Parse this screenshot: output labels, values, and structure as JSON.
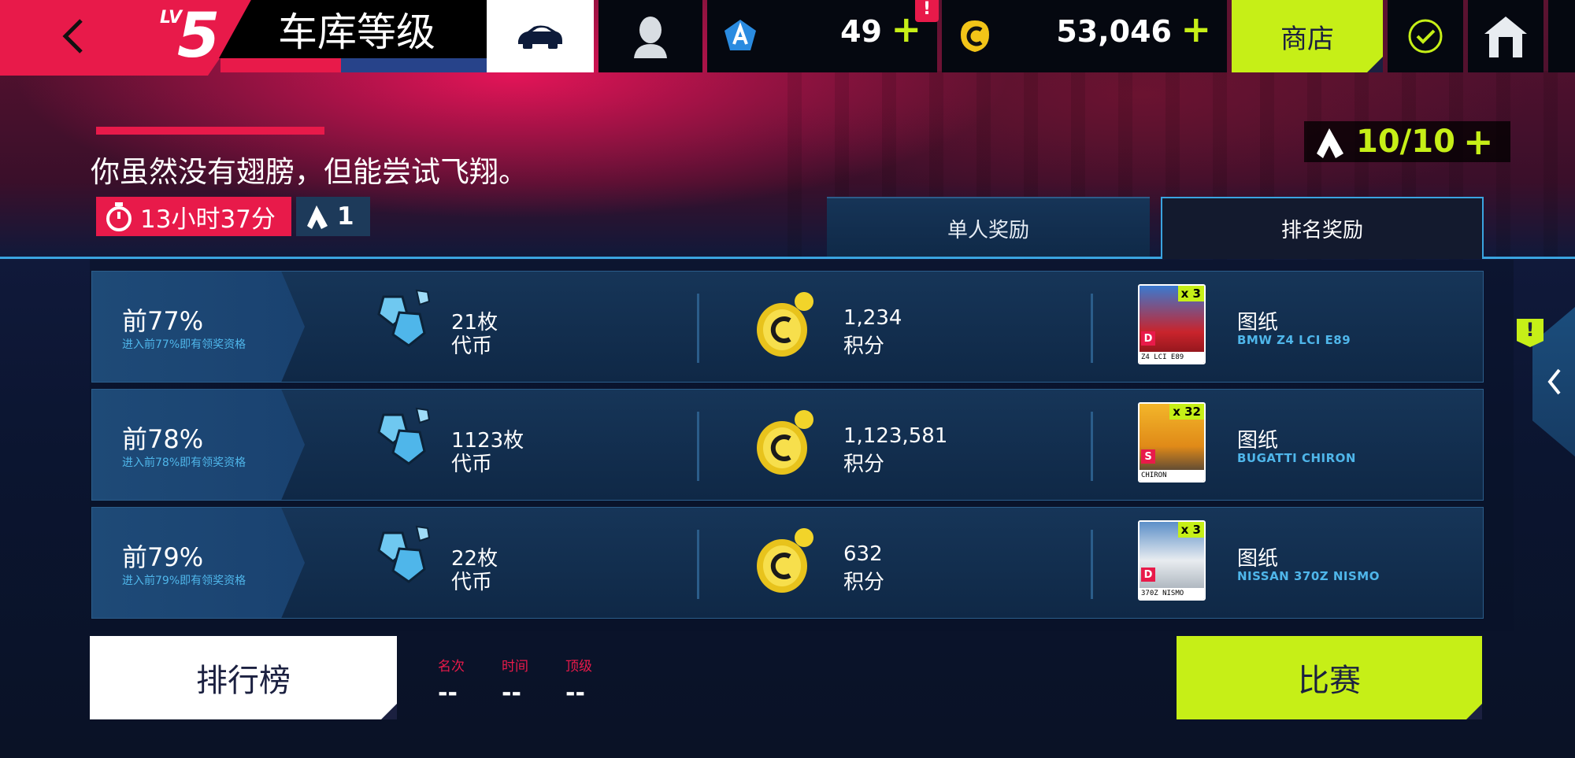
{
  "topbar": {
    "level_label": "LV",
    "level": "5",
    "title": "车库等级",
    "tokens": "49",
    "tokens_plus": "+",
    "tokens_alert": "!",
    "credits": "53,046",
    "credits_plus": "+",
    "shop_label": "商店"
  },
  "header": {
    "subtitle": "你虽然没有翅膀，但能尝试飞翔。",
    "timer": "13小时37分",
    "token_count": "1",
    "energy": "10/10",
    "energy_plus": "+"
  },
  "tabs": [
    {
      "label": "单人奖励",
      "active": false
    },
    {
      "label": "排名奖励",
      "active": true
    }
  ],
  "rewards": [
    {
      "rank": "前77%",
      "rank_sub": "进入前77%即有领奖资格",
      "tokens_value": "21枚",
      "tokens_unit": "代币",
      "credits_value": "1,234",
      "credits_unit": "积分",
      "blueprint_label": "图纸",
      "car_name": "BMW Z4 LCI E89",
      "card_multiplier": "x 3",
      "card_class": "D",
      "card_caption": "Z4 LCI E89",
      "card_color": "#c9242c"
    },
    {
      "rank": "前78%",
      "rank_sub": "进入前78%即有领奖资格",
      "tokens_value": "1123枚",
      "tokens_unit": "代币",
      "credits_value": "1,123,581",
      "credits_unit": "积分",
      "blueprint_label": "图纸",
      "car_name": "BUGATTI CHIRON",
      "card_multiplier": "x 32",
      "card_class": "S",
      "card_caption": "CHIRON",
      "card_color": "#f0a020"
    },
    {
      "rank": "前79%",
      "rank_sub": "进入前79%即有领奖资格",
      "tokens_value": "22枚",
      "tokens_unit": "代币",
      "credits_value": "632",
      "credits_unit": "积分",
      "blueprint_label": "图纸",
      "car_name": "NISSAN 370Z NISMO",
      "card_multiplier": "x 3",
      "card_class": "D",
      "card_caption": "370Z NISMO",
      "card_color": "#d8dde2"
    }
  ],
  "drawer_alert": "!",
  "bottom": {
    "leaderboard_label": "排行榜",
    "stats": [
      {
        "label": "名次",
        "value": "--"
      },
      {
        "label": "时间",
        "value": "--"
      },
      {
        "label": "顶级",
        "value": "--"
      }
    ],
    "race_label": "比赛"
  },
  "colors": {
    "accent_pink": "#e81a4a",
    "accent_lime": "#c6ef17",
    "link_blue": "#4fb6ea"
  }
}
